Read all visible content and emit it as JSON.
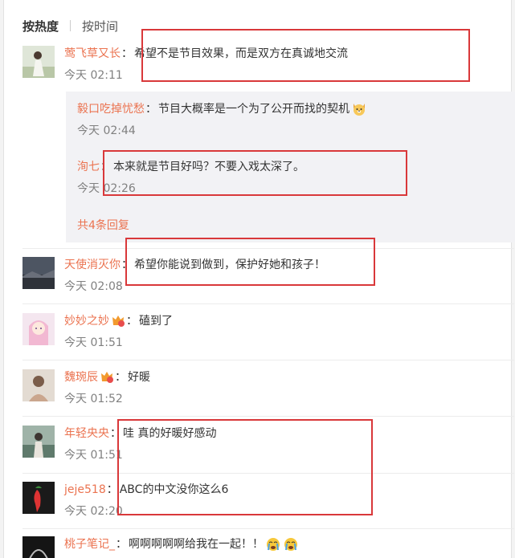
{
  "sort_tabs": {
    "hot": "按热度",
    "time": "按时间"
  },
  "comments": [
    {
      "user": "莺飞草又长",
      "text": "希望不是节目效果，而是双方在真诚地交流",
      "time": "今天 02:11"
    },
    {
      "user": "天使消灭你",
      "text": "希望你能说到做到，保护好她和孩子！",
      "time": "今天 02:08"
    },
    {
      "user": "妙妙之妙",
      "text": "磕到了",
      "time": "今天 01:51"
    },
    {
      "user": "魏琬辰",
      "text": "好暖",
      "time": "今天 01:52"
    },
    {
      "user": "年轻央央",
      "text": "哇 真的好暖好感动",
      "time": "今天 01:51"
    },
    {
      "user": "jeje518",
      "text": "ABC的中文没你这么6",
      "time": "今天 02:20"
    },
    {
      "user": "桃子笔记_",
      "text": "啊啊啊啊啊给我在一起！！"
    }
  ],
  "replies": [
    {
      "user": "毅口吃掉忧愁",
      "text": "节目大概率是一个为了公开而找的契机",
      "time": "今天 02:44"
    },
    {
      "user": "洵七",
      "text": "本来就是节目好吗？不要入戏太深了。",
      "time": "今天 02:26"
    }
  ],
  "more_replies": "共4条回复",
  "colon": "：",
  "icons": {
    "badge": "vip-badge-icon",
    "dog_emoji": "dog-emoji-icon",
    "crying_emoji": "crying-emoji-icon"
  },
  "colors": {
    "username": "#eb7350",
    "highlight_box": "#d9383a",
    "reply_bg": "#f2f2f5"
  }
}
